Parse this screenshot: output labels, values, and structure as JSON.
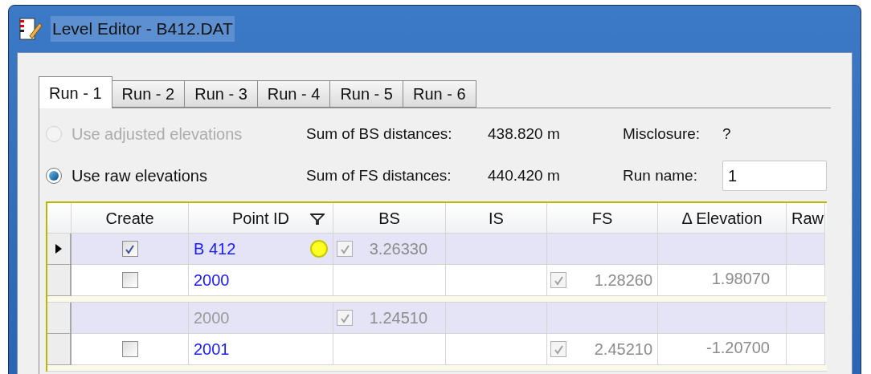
{
  "window": {
    "title": "Level Editor - B412.DAT"
  },
  "tabs": [
    {
      "label": "Run - 1",
      "selected": true
    },
    {
      "label": "Run - 2",
      "selected": false
    },
    {
      "label": "Run - 3",
      "selected": false
    },
    {
      "label": "Run - 4",
      "selected": false
    },
    {
      "label": "Run - 5",
      "selected": false
    },
    {
      "label": "Run - 6",
      "selected": false
    }
  ],
  "options": [
    {
      "label": "Use adjusted elevations",
      "selected": false,
      "disabled": true
    },
    {
      "label": "Use raw elevations",
      "selected": true,
      "disabled": false
    }
  ],
  "stats": [
    {
      "label": "Sum of BS distances:",
      "value": "438.820 m",
      "label2": "Misclosure:",
      "value2": "?"
    },
    {
      "label": "Sum of FS distances:",
      "value": "440.420 m",
      "label2": "Run name:",
      "field": "1"
    }
  ],
  "table": {
    "columns": [
      "Create",
      "Point ID",
      "BS",
      "IS",
      "FS",
      "Δ Elevation",
      "Raw"
    ],
    "groups": [
      {
        "rows": [
          {
            "kind": "backsight",
            "current": true,
            "create_checked": true,
            "point_id": "B 412",
            "marker": true,
            "bs_checked": true,
            "bs": "3.26330"
          },
          {
            "kind": "foresight",
            "current": false,
            "create_checked": false,
            "point_id": "2000",
            "fs_checked": true,
            "fs": "1.28260",
            "delta": "1.98070"
          }
        ]
      },
      {
        "rows": [
          {
            "kind": "backsight",
            "current": false,
            "point_id": "2000",
            "bs_checked": true,
            "bs": "1.24510"
          },
          {
            "kind": "foresight",
            "current": false,
            "create_checked": false,
            "point_id": "2001",
            "fs_checked": true,
            "fs": "2.45210",
            "delta": "-1.20700"
          }
        ]
      }
    ]
  }
}
